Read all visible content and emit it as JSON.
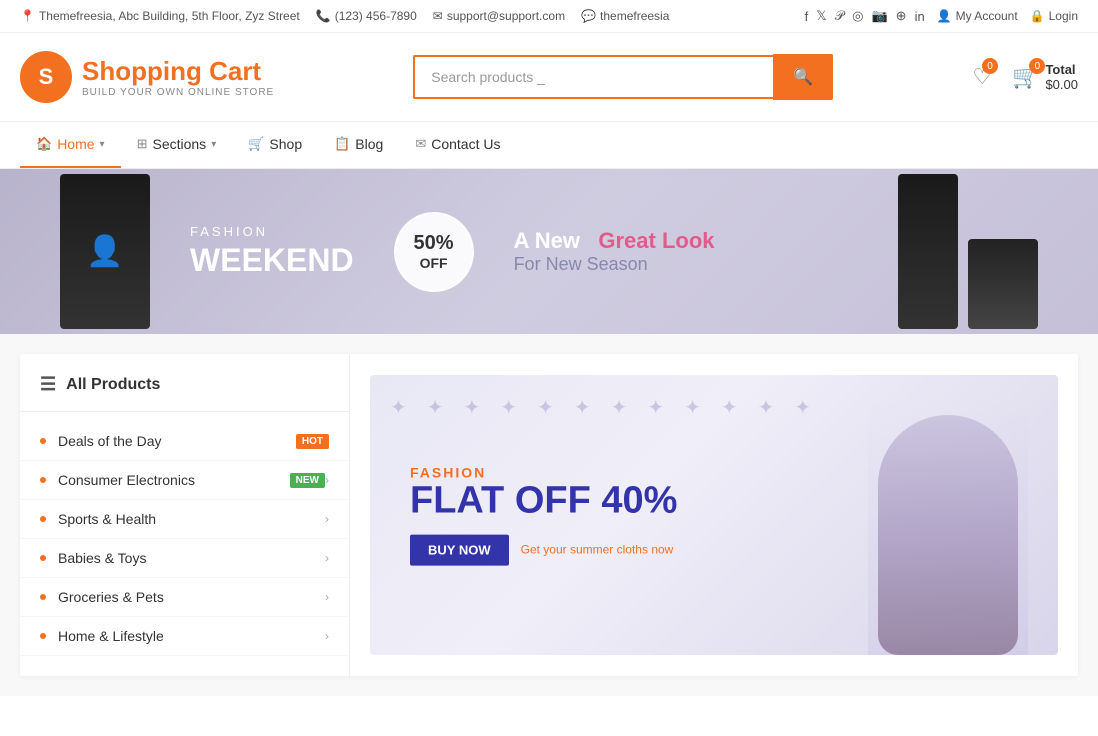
{
  "topbar": {
    "address": "Themefreesia, Abc Building, 5th Floor, Zyz Street",
    "phone": "(123) 456-7890",
    "email": "support@support.com",
    "skype": "themefreesia",
    "social_icons": [
      "facebook",
      "twitter",
      "pinterest",
      "dribbble",
      "instagram",
      "flickr",
      "linkedin"
    ],
    "account_label": "My Account",
    "login_label": "Login"
  },
  "header": {
    "logo_letter": "S",
    "logo_title": "Shopping Cart",
    "logo_tagline": "BUILD YOUR OWN ONLINE STORE",
    "search_placeholder": "Search products...",
    "search_cursor": "_",
    "wishlist_count": "0",
    "cart_count": "0",
    "total_label": "Total",
    "total_amount": "$0.00"
  },
  "nav": {
    "items": [
      {
        "label": "Home",
        "icon": "home",
        "has_arrow": true
      },
      {
        "label": "Sections",
        "icon": "grid",
        "has_arrow": true
      },
      {
        "label": "Shop",
        "icon": "cart"
      },
      {
        "label": "Blog",
        "icon": "layout"
      },
      {
        "label": "Contact Us",
        "icon": "envelope"
      }
    ]
  },
  "banner": {
    "label": "FASHION",
    "title_line1": "FASHION",
    "title_line2": "WEEKEND",
    "circle_percent": "50%",
    "circle_off": "OFF",
    "tagline_new": "A New",
    "tagline_great": "Great Look",
    "tagline_season": "For New Season"
  },
  "sidebar": {
    "title": "All Products",
    "items": [
      {
        "label": "Deals of the Day",
        "badge": "HOT",
        "badge_type": "hot",
        "has_arrow": false
      },
      {
        "label": "Consumer Electronics",
        "badge": "NEW",
        "badge_type": "new",
        "has_arrow": true
      },
      {
        "label": "Sports & Health",
        "has_arrow": true
      },
      {
        "label": "Babies & Toys",
        "has_arrow": true
      },
      {
        "label": "Groceries & Pets",
        "has_arrow": true
      },
      {
        "label": "Home & Lifestyle",
        "has_arrow": true
      }
    ]
  },
  "promo": {
    "label": "FASHION",
    "title": "FLAT OFF 40%",
    "buy_label": "BUY NOW",
    "subtitle": "Get your summer cloths now"
  }
}
